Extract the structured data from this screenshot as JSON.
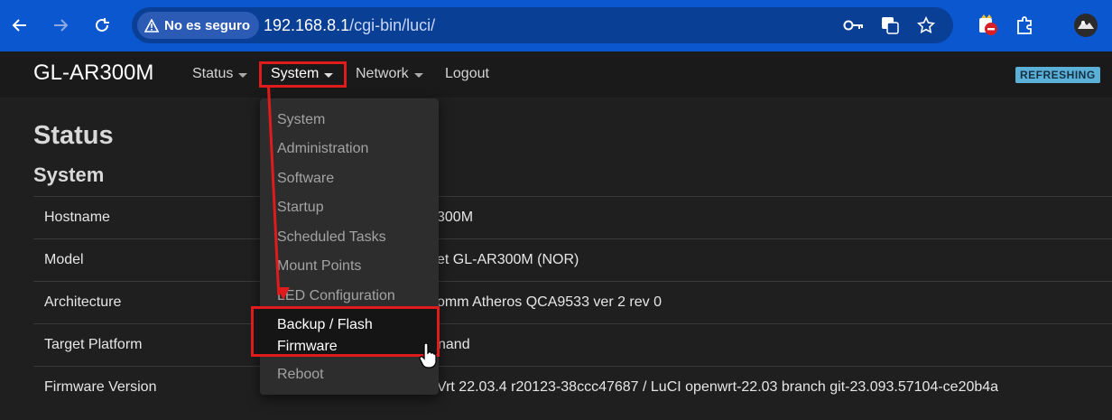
{
  "browser": {
    "security_label": "No es seguro",
    "url_host": "192.168.8.1",
    "url_path": "/cgi-bin/luci/"
  },
  "router": {
    "brand": "GL-AR300M",
    "menu": [
      {
        "label": "Status"
      },
      {
        "label": "System"
      },
      {
        "label": "Network"
      },
      {
        "label": "Logout"
      }
    ],
    "badge": "REFRESHING"
  },
  "page": {
    "title": "Status",
    "section": "System",
    "rows": [
      {
        "key": "Hostname",
        "value": "300M"
      },
      {
        "key": "Model",
        "value": "et GL-AR300M (NOR)"
      },
      {
        "key": "Architecture",
        "value": "omm Atheros QCA9533 ver 2 rev 0"
      },
      {
        "key": "Target Platform",
        "value": "nand"
      },
      {
        "key": "Firmware Version",
        "value": "Vrt 22.03.4 r20123-38ccc47687 / LuCI openwrt-22.03 branch git-23.093.57104-ce20b4a"
      }
    ]
  },
  "dropdown": {
    "items": [
      {
        "label": "System"
      },
      {
        "label": "Administration"
      },
      {
        "label": "Software"
      },
      {
        "label": "Startup"
      },
      {
        "label": "Scheduled Tasks"
      },
      {
        "label": "Mount Points"
      },
      {
        "label": "LED Configuration"
      },
      {
        "label": "Backup / Flash"
      },
      {
        "label": "Firmware"
      },
      {
        "label": "Reboot"
      }
    ]
  },
  "colors": {
    "chrome_blue": "#0b57d0",
    "annotation_red": "#e01b1b",
    "badge_blue": "#5bb0d8"
  }
}
